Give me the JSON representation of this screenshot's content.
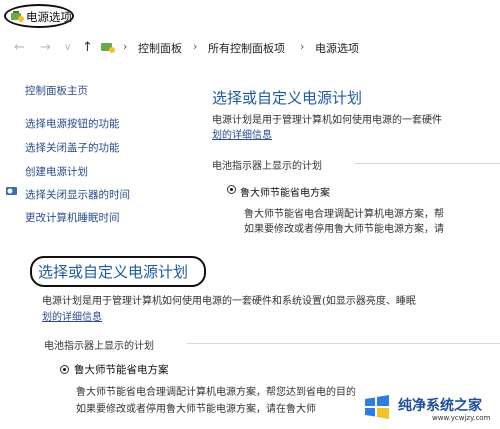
{
  "window": {
    "title": "电源选项"
  },
  "nav": {
    "back": "←",
    "forward": "→",
    "dropdown": "∨",
    "up": "↑"
  },
  "address": {
    "items": [
      "控制面板",
      "所有控制面板项",
      "电源选项"
    ],
    "separator": "›"
  },
  "sidebar": {
    "items": [
      {
        "label": "控制面板主页",
        "icon": ""
      },
      {
        "label": "选择电源按钮的功能",
        "icon": ""
      },
      {
        "label": "选择关闭盖子的功能",
        "icon": ""
      },
      {
        "label": "创建电源计划",
        "icon": ""
      },
      {
        "label": "选择关闭显示器的时间",
        "icon": "monitor-icon"
      },
      {
        "label": "更改计算机睡眠时间",
        "icon": "moon-icon"
      }
    ]
  },
  "main": {
    "heading": "选择或自定义电源计划",
    "desc": "电源计划是用于管理计算机如何使用电源的一套硬件",
    "desc_link": "划的详细信息",
    "section": "电池指示器上显示的计划",
    "plan_name": "鲁大师节能省电方案",
    "plan_desc_1": "鲁大师节能省电合理调配计算机电源方案，帮",
    "plan_desc_2": "如果要修改或者停用鲁大师节能电源方案，请"
  },
  "zoom": {
    "heading": "选择或自定义电源计划",
    "desc": "电源计划是用于管理计算机如何使用电源的一套硬件和系统设置(如显示器亮度、睡眠",
    "desc_link": "划的详细信息",
    "section": "电池指示器上显示的计划",
    "plan_name": "鲁大师节能省电方案",
    "plan_desc_1": "鲁大师节能省电合理调配计算机电源方案，帮您达到省电的目的",
    "plan_desc_2": "如果要修改或者停用鲁大师节能电源方案，请在鲁大师"
  },
  "watermark": {
    "name": "纯净系统之家",
    "url": "www.ycwjzy.com"
  },
  "colors": {
    "link": "#2a4d8f",
    "heading": "#1e5aa8",
    "watermark": "#1f4e9a"
  }
}
